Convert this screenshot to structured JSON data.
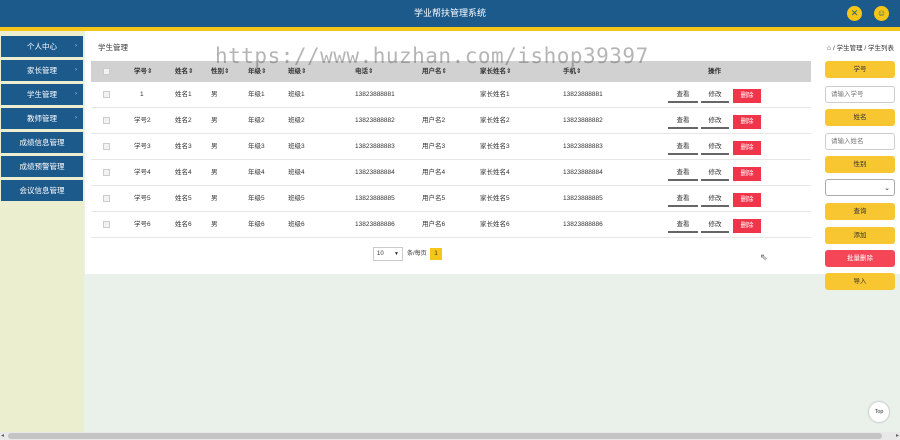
{
  "header": {
    "title": "学业帮扶管理系统",
    "icons": [
      "expand-icon",
      "user-icon"
    ]
  },
  "sidebar": {
    "items": [
      {
        "label": "个人中心"
      },
      {
        "label": "家长管理"
      },
      {
        "label": "学生管理"
      },
      {
        "label": "教师管理"
      },
      {
        "label": "成绩信息管理"
      },
      {
        "label": "成绩预警管理"
      },
      {
        "label": "会议信息管理"
      }
    ]
  },
  "page": {
    "title": "学生管理",
    "breadcrumb": "/ 学生管理 / 学生列表"
  },
  "table": {
    "columns": [
      "学号⇕",
      "姓名⇕",
      "性别⇕",
      "年级⇕",
      "班级⇕",
      "电话⇕",
      "用户名⇕",
      "家长姓名⇕",
      "手机⇕",
      "操作"
    ],
    "rows": [
      [
        "1",
        "姓名1",
        "男",
        "年级1",
        "班级1",
        "13823888881",
        "",
        "家长姓名1",
        "13823888881"
      ],
      [
        "学号2",
        "姓名2",
        "男",
        "年级2",
        "班级2",
        "13823888882",
        "用户名2",
        "家长姓名2",
        "13823888882"
      ],
      [
        "学号3",
        "姓名3",
        "男",
        "年级3",
        "班级3",
        "13823888883",
        "用户名3",
        "家长姓名3",
        "13823888883"
      ],
      [
        "学号4",
        "姓名4",
        "男",
        "年级4",
        "班级4",
        "13823888884",
        "用户名4",
        "家长姓名4",
        "13823888884"
      ],
      [
        "学号5",
        "姓名5",
        "男",
        "年级5",
        "班级5",
        "13823888885",
        "用户名5",
        "家长姓名5",
        "13823888885"
      ],
      [
        "学号6",
        "姓名6",
        "男",
        "年级6",
        "班级6",
        "13823888886",
        "用户名6",
        "家长姓名6",
        "13823888886"
      ]
    ],
    "actions": {
      "view": "查看",
      "edit": "修改",
      "delete": "删除"
    }
  },
  "pagination": {
    "page_size": "10",
    "per_page_label": "条/每页",
    "current_page": "1"
  },
  "search": {
    "student_no_label": "学号",
    "student_no_placeholder": "请输入学号",
    "name_label": "姓名",
    "name_placeholder": "请输入姓名",
    "gender_label": "性别",
    "gender_value": "",
    "query_button": "查询",
    "add_button": "添加",
    "batch_delete_button": "批量删除",
    "import_button": "导入"
  },
  "watermark": "https://www.huzhan.com/ishop39397",
  "back_to_top": "Top",
  "colors": {
    "header": "#1d5a8c",
    "accent": "#f5c518",
    "delete": "#f0344a",
    "sidebar_bg": "#ebefd0"
  }
}
